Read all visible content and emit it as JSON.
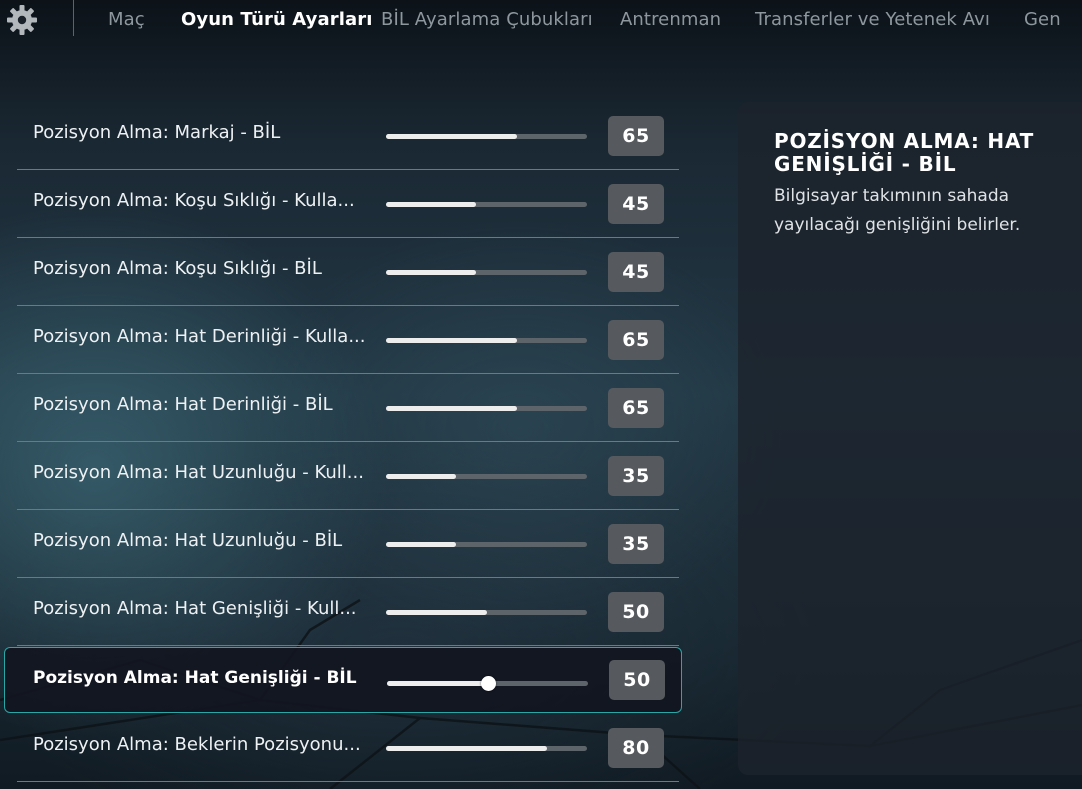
{
  "nav": {
    "tabs": [
      {
        "label": "Maç",
        "active": false
      },
      {
        "label": "Oyun Türü Ayarları",
        "active": true
      },
      {
        "label": "BİL Ayarlama Çubukları",
        "active": false
      },
      {
        "label": "Antrenman",
        "active": false
      },
      {
        "label": "Transferler ve Yetenek Avı",
        "active": false
      },
      {
        "label": "Gen",
        "active": false
      }
    ],
    "settings_icon": "gear-icon"
  },
  "settings": [
    {
      "label": "Pozisyon Alma: Markaj - BİL",
      "value": "65",
      "slider_fraction": 0.65,
      "selected": false
    },
    {
      "label": "Pozisyon Alma: Koşu Sıklığı - Kulla...",
      "value": "45",
      "slider_fraction": 0.45,
      "selected": false
    },
    {
      "label": "Pozisyon Alma: Koşu Sıklığı - BİL",
      "value": "45",
      "slider_fraction": 0.45,
      "selected": false
    },
    {
      "label": "Pozisyon Alma: Hat Derinliği - Kulla...",
      "value": "65",
      "slider_fraction": 0.65,
      "selected": false
    },
    {
      "label": "Pozisyon Alma: Hat Derinliği - BİL",
      "value": "65",
      "slider_fraction": 0.65,
      "selected": false
    },
    {
      "label": "Pozisyon Alma: Hat Uzunluğu - Kull...",
      "value": "35",
      "slider_fraction": 0.35,
      "selected": false
    },
    {
      "label": "Pozisyon Alma: Hat Uzunluğu - BİL",
      "value": "35",
      "slider_fraction": 0.35,
      "selected": false
    },
    {
      "label": "Pozisyon Alma: Hat Genişliği - Kull...",
      "value": "50",
      "slider_fraction": 0.5,
      "selected": false
    },
    {
      "label": "Pozisyon Alma: Hat Genişliği - BİL",
      "value": "50",
      "slider_fraction": 0.5,
      "selected": true
    },
    {
      "label": "Pozisyon Alma: Beklerin Pozisyonu...",
      "value": "80",
      "slider_fraction": 0.8,
      "selected": false
    }
  ],
  "info_panel": {
    "title": "POZİSYON ALMA: HAT GENİŞLİĞİ - BİL",
    "description": "Bilgisayar takımının sahada yayılacağı genişliğini belirler."
  },
  "colors": {
    "selected_border": "#29a6a6",
    "value_box": "#565a5e",
    "slider_fill": "#ededed",
    "slider_track": "#5d646a"
  }
}
